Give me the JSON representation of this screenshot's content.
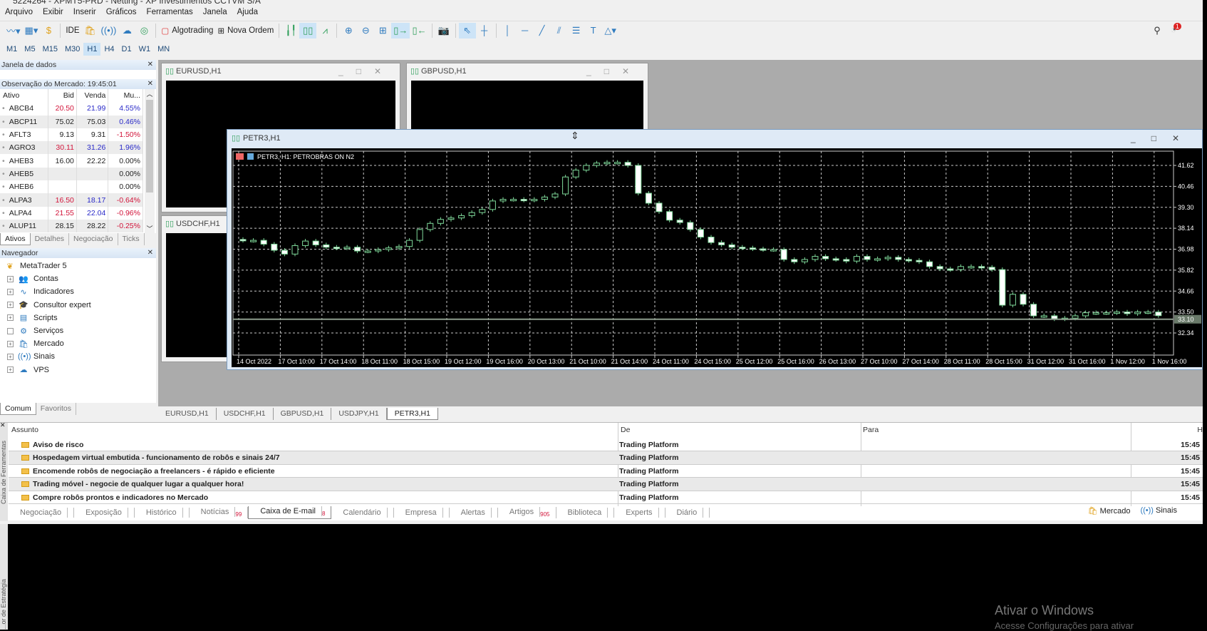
{
  "window_title": "5224264 - XPMT5-PRD - Netting - XP Investimentos CCTVM S/A",
  "menu": [
    "Arquivo",
    "Exibir",
    "Inserir",
    "Gráficos",
    "Ferramentas",
    "Janela",
    "Ajuda"
  ],
  "toolbar": {
    "ide": "IDE",
    "algotrading": "Algotrading",
    "new_order": "Nova Ordem",
    "notification_count": "1"
  },
  "timeframes": [
    "M1",
    "M5",
    "M15",
    "M30",
    "H1",
    "H4",
    "D1",
    "W1",
    "MN"
  ],
  "active_timeframe": "H1",
  "data_window": {
    "title": "Janela de dados"
  },
  "market_watch": {
    "title": "Observação do Mercado: 19:45:01",
    "columns": [
      "Ativo",
      "Bid",
      "Venda",
      "Mu..."
    ],
    "rows": [
      {
        "symbol": "ABCB4",
        "bid": "20.50",
        "ask": "21.99",
        "change": "4.55%",
        "bid_color": "red",
        "ask_color": "blue",
        "chg_color": "blue"
      },
      {
        "symbol": "ABCP11",
        "bid": "75.02",
        "ask": "75.03",
        "change": "0.46%",
        "bid_color": "",
        "ask_color": "",
        "chg_color": "blue"
      },
      {
        "symbol": "AFLT3",
        "bid": "9.13",
        "ask": "9.31",
        "change": "-1.50%",
        "bid_color": "",
        "ask_color": "",
        "chg_color": "red"
      },
      {
        "symbol": "AGRO3",
        "bid": "30.11",
        "ask": "31.26",
        "change": "1.96%",
        "bid_color": "red",
        "ask_color": "blue",
        "chg_color": "blue"
      },
      {
        "symbol": "AHEB3",
        "bid": "16.00",
        "ask": "22.22",
        "change": "0.00%",
        "bid_color": "",
        "ask_color": "",
        "chg_color": ""
      },
      {
        "symbol": "AHEB5",
        "bid": "",
        "ask": "",
        "change": "0.00%",
        "bid_color": "",
        "ask_color": "",
        "chg_color": ""
      },
      {
        "symbol": "AHEB6",
        "bid": "",
        "ask": "",
        "change": "0.00%",
        "bid_color": "",
        "ask_color": "",
        "chg_color": ""
      },
      {
        "symbol": "ALPA3",
        "bid": "16.50",
        "ask": "18.17",
        "change": "-0.64%",
        "bid_color": "red",
        "ask_color": "blue",
        "chg_color": "red"
      },
      {
        "symbol": "ALPA4",
        "bid": "21.55",
        "ask": "22.04",
        "change": "-0.96%",
        "bid_color": "red",
        "ask_color": "blue",
        "chg_color": "red"
      },
      {
        "symbol": "ALUP11",
        "bid": "28.15",
        "ask": "28.22",
        "change": "-0.25%",
        "bid_color": "",
        "ask_color": "",
        "chg_color": "red"
      }
    ],
    "tabs": [
      "Ativos",
      "Detalhes",
      "Negociação",
      "Ticks"
    ]
  },
  "navigator": {
    "title": "Navegador",
    "root": "MetaTrader 5",
    "items": [
      {
        "label": "Contas",
        "icon": "accounts-icon",
        "glyph": "👥"
      },
      {
        "label": "Indicadores",
        "icon": "indicators-icon",
        "glyph": "∿"
      },
      {
        "label": "Consultor expert",
        "icon": "expert-icon",
        "glyph": "🎓"
      },
      {
        "label": "Scripts",
        "icon": "scripts-icon",
        "glyph": "▤"
      },
      {
        "label": "Serviços",
        "icon": "services-icon",
        "glyph": "⚙"
      },
      {
        "label": "Mercado",
        "icon": "market-icon",
        "glyph": "🛍"
      },
      {
        "label": "Sinais",
        "icon": "signals-icon",
        "glyph": "((•))"
      },
      {
        "label": "VPS",
        "icon": "vps-icon",
        "glyph": "☁"
      }
    ],
    "tabs": [
      "Comum",
      "Favoritos"
    ]
  },
  "chart_windows": {
    "eurusd": "EURUSD,H1",
    "gbpusd": "GBPUSD,H1",
    "usdchf": "USDCHF,H1",
    "petr3": "PETR3,H1"
  },
  "chart_tabs": [
    "EURUSD,H1",
    "USDCHF,H1",
    "GBPUSD,H1",
    "USDJPY,H1",
    "PETR3,H1"
  ],
  "active_chart_tab": "PETR3,H1",
  "chart_data": {
    "type": "candlestick",
    "header": "PETR3, H1:  PETROBRAS   ON     N2",
    "y_ticks": [
      "41.62",
      "40.46",
      "39.30",
      "38.14",
      "36.98",
      "35.82",
      "34.66",
      "33.50",
      "32.34"
    ],
    "ylim": [
      32.0,
      42.1
    ],
    "current_price": "33.10",
    "x_tick_labels": [
      "14 Oct 2022",
      "17 Oct 10:00",
      "17 Oct 14:00",
      "18 Oct 11:00",
      "18 Oct 15:00",
      "19 Oct 12:00",
      "19 Oct 16:00",
      "20 Oct 13:00",
      "21 Oct 10:00",
      "21 Oct 14:00",
      "24 Oct 11:00",
      "24 Oct 15:00",
      "25 Oct 12:00",
      "25 Oct 16:00",
      "26 Oct 13:00",
      "27 Oct 10:00",
      "27 Oct 14:00",
      "28 Oct 11:00",
      "28 Oct 15:00",
      "31 Oct 12:00",
      "31 Oct 16:00",
      "1 Nov 12:00",
      "1 Nov 16:00"
    ],
    "close": [
      37.47,
      37.47,
      37.26,
      36.92,
      36.71,
      37.18,
      37.43,
      37.22,
      37.09,
      37.05,
      37.09,
      36.88,
      36.88,
      36.96,
      37.05,
      37.13,
      37.47,
      38.07,
      38.41,
      38.63,
      38.71,
      38.84,
      39.01,
      39.18,
      39.65,
      39.74,
      39.74,
      39.7,
      39.74,
      39.87,
      40.04,
      40.98,
      41.36,
      41.62,
      41.75,
      41.79,
      41.79,
      41.62,
      40.08,
      39.53,
      39.06,
      38.59,
      38.46,
      38.07,
      37.65,
      37.35,
      37.22,
      37.09,
      37.05,
      37.0,
      36.96,
      36.96,
      36.41,
      36.28,
      36.41,
      36.58,
      36.45,
      36.41,
      36.32,
      36.58,
      36.41,
      36.45,
      36.53,
      36.41,
      36.36,
      36.28,
      36.02,
      35.89,
      35.85,
      36.02,
      36.02,
      35.98,
      35.85,
      33.88,
      34.48,
      33.93,
      33.29,
      33.29,
      33.12,
      33.16,
      33.29,
      33.46,
      33.46,
      33.46,
      33.5,
      33.41,
      33.5,
      33.5,
      33.3
    ],
    "colors": {
      "background": "#000000",
      "grid": "#c8c8c8",
      "candle": "#ffffff",
      "wick": "#7fd99a",
      "volume": "#3fb46a",
      "axis_text": "#ffffff"
    },
    "grid": true
  },
  "mailbox": {
    "columns": [
      "Assunto",
      "De",
      "Para",
      "H"
    ],
    "rows": [
      {
        "subject": "Aviso de risco",
        "from": "Trading Platform",
        "to": "",
        "time": "15:45"
      },
      {
        "subject": "Hospedagem virtual embutida - funcionamento de robôs e sinais 24/7",
        "from": "Trading Platform",
        "to": "",
        "time": "15:45"
      },
      {
        "subject": "Encomende robôs de negociação a freelancers - é rápido e eficiente",
        "from": "Trading Platform",
        "to": "",
        "time": "15:45"
      },
      {
        "subject": "Trading móvel - negocie de qualquer lugar a qualquer hora!",
        "from": "Trading Platform",
        "to": "",
        "time": "15:45"
      },
      {
        "subject": "Compre robôs prontos e indicadores no Mercado",
        "from": "Trading Platform",
        "to": "",
        "time": "15:45"
      }
    ]
  },
  "toolbox": {
    "side_label": "Caixa de Ferramentas",
    "tabs": [
      {
        "label": "Negociação",
        "badge": ""
      },
      {
        "label": "Exposição",
        "badge": ""
      },
      {
        "label": "Histórico",
        "badge": ""
      },
      {
        "label": "Notícias",
        "badge": "99"
      },
      {
        "label": "Caixa de E-mail",
        "badge": "8"
      },
      {
        "label": "Calendário",
        "badge": ""
      },
      {
        "label": "Empresa",
        "badge": ""
      },
      {
        "label": "Alertas",
        "badge": ""
      },
      {
        "label": "Artigos",
        "badge": "905"
      },
      {
        "label": "Biblioteca",
        "badge": ""
      },
      {
        "label": "Experts",
        "badge": ""
      },
      {
        "label": "Diário",
        "badge": ""
      }
    ],
    "active_tab": "Caixa de E-mail",
    "market_link": "Mercado",
    "signals_link": "Sinais"
  },
  "strategy_tester_side_label": "...or de Estratégia",
  "windows_watermark": {
    "line1": "Ativar o Windows",
    "line2": "Acesse Configurações para ativar"
  }
}
